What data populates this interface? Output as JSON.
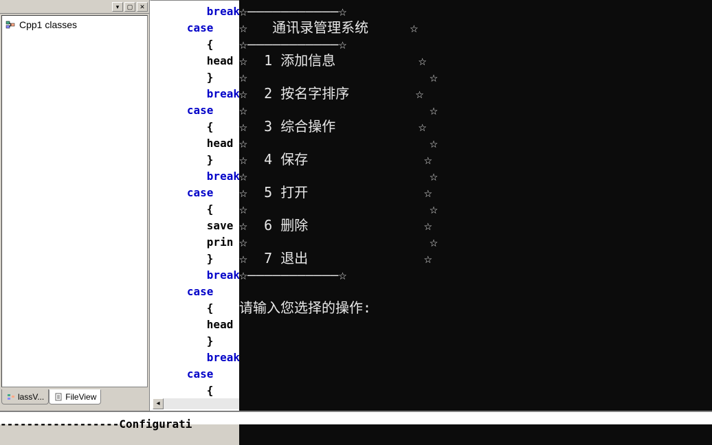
{
  "sidebar": {
    "tree_item": "Cpp1 classes",
    "tabs": {
      "classview": "lassV...",
      "fileview": "FileView"
    }
  },
  "code": {
    "lines": [
      {
        "indent": 2,
        "kw": true,
        "text": "break"
      },
      {
        "indent": 1,
        "kw": true,
        "text": "case"
      },
      {
        "indent": 2,
        "kw": false,
        "text": "{"
      },
      {
        "indent": 2,
        "kw": false,
        "text": "head"
      },
      {
        "indent": 2,
        "kw": false,
        "text": "}"
      },
      {
        "indent": 2,
        "kw": true,
        "text": "break"
      },
      {
        "indent": 1,
        "kw": true,
        "text": "case"
      },
      {
        "indent": 2,
        "kw": false,
        "text": "{"
      },
      {
        "indent": 2,
        "kw": false,
        "text": "head"
      },
      {
        "indent": 2,
        "kw": false,
        "text": "}"
      },
      {
        "indent": 2,
        "kw": true,
        "text": "break"
      },
      {
        "indent": 1,
        "kw": true,
        "text": "case"
      },
      {
        "indent": 2,
        "kw": false,
        "text": "{"
      },
      {
        "indent": 2,
        "kw": false,
        "text": "save"
      },
      {
        "indent": 2,
        "kw": false,
        "text": "prin"
      },
      {
        "indent": 2,
        "kw": false,
        "text": "}"
      },
      {
        "indent": 2,
        "kw": true,
        "text": "break"
      },
      {
        "indent": 1,
        "kw": true,
        "text": "case"
      },
      {
        "indent": 2,
        "kw": false,
        "text": "{"
      },
      {
        "indent": 2,
        "kw": false,
        "text": "head"
      },
      {
        "indent": 2,
        "kw": false,
        "text": "}"
      },
      {
        "indent": 2,
        "kw": true,
        "text": "break"
      },
      {
        "indent": 1,
        "kw": true,
        "text": "case"
      },
      {
        "indent": 2,
        "kw": false,
        "text": "{"
      }
    ]
  },
  "console": {
    "star": "☆",
    "title": "通讯录管理系统",
    "menu": [
      {
        "num": "1",
        "label": "添加信息"
      },
      {
        "num": "2",
        "label": "按名字排序"
      },
      {
        "num": "3",
        "label": "综合操作"
      },
      {
        "num": "4",
        "label": "保存"
      },
      {
        "num": "5",
        "label": "打开"
      },
      {
        "num": "6",
        "label": "删除"
      },
      {
        "num": "7",
        "label": "退出"
      }
    ],
    "prompt": "请输入您选择的操作:"
  },
  "output": {
    "config_line": "------------------Configurati"
  }
}
